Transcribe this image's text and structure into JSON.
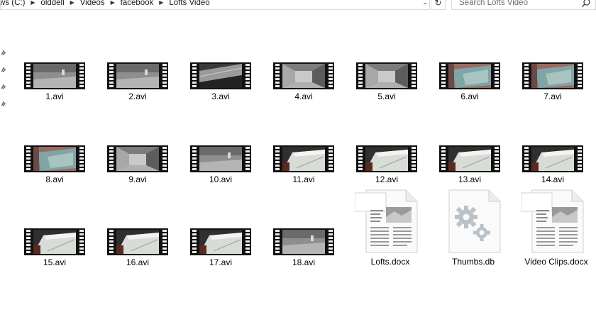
{
  "address_bar": {
    "crumbs": [
      "ws (C:)",
      "olddell",
      "Videos",
      "facebook",
      "Lofts Video"
    ]
  },
  "search": {
    "placeholder": "Search Lofts Video"
  },
  "files": [
    {
      "name": "1.avi",
      "scene": "gray-hall"
    },
    {
      "name": "2.avi",
      "scene": "gray-hall"
    },
    {
      "name": "3.avi",
      "scene": "dark-stripe"
    },
    {
      "name": "4.avi",
      "scene": "corridor"
    },
    {
      "name": "5.avi",
      "scene": "corridor"
    },
    {
      "name": "6.avi",
      "scene": "tinted-teal"
    },
    {
      "name": "7.avi",
      "scene": "tinted-teal"
    },
    {
      "name": "8.avi",
      "scene": "tinted-teal"
    },
    {
      "name": "9.avi",
      "scene": "corridor"
    },
    {
      "name": "10.avi",
      "scene": "gray-hall"
    },
    {
      "name": "11.avi",
      "scene": "bright-floor"
    },
    {
      "name": "12.avi",
      "scene": "bright-floor"
    },
    {
      "name": "13.avi",
      "scene": "bright-floor"
    },
    {
      "name": "14.avi",
      "scene": "bright-floor"
    },
    {
      "name": "15.avi",
      "scene": "bright-floor"
    },
    {
      "name": "16.avi",
      "scene": "bright-floor"
    },
    {
      "name": "17.avi",
      "scene": "bright-floor"
    },
    {
      "name": "18.avi",
      "scene": "gray-hall"
    }
  ],
  "documents": [
    {
      "name": "Lofts.docx",
      "icon": "word-document-icon"
    },
    {
      "name": "Thumbs.db",
      "icon": "system-file-gears-icon"
    },
    {
      "name": "Video Clips.docx",
      "icon": "word-document-icon"
    }
  ],
  "colors": {
    "border": "#d9d9d9",
    "gear": "#b9c2c8",
    "text": "#000000"
  }
}
